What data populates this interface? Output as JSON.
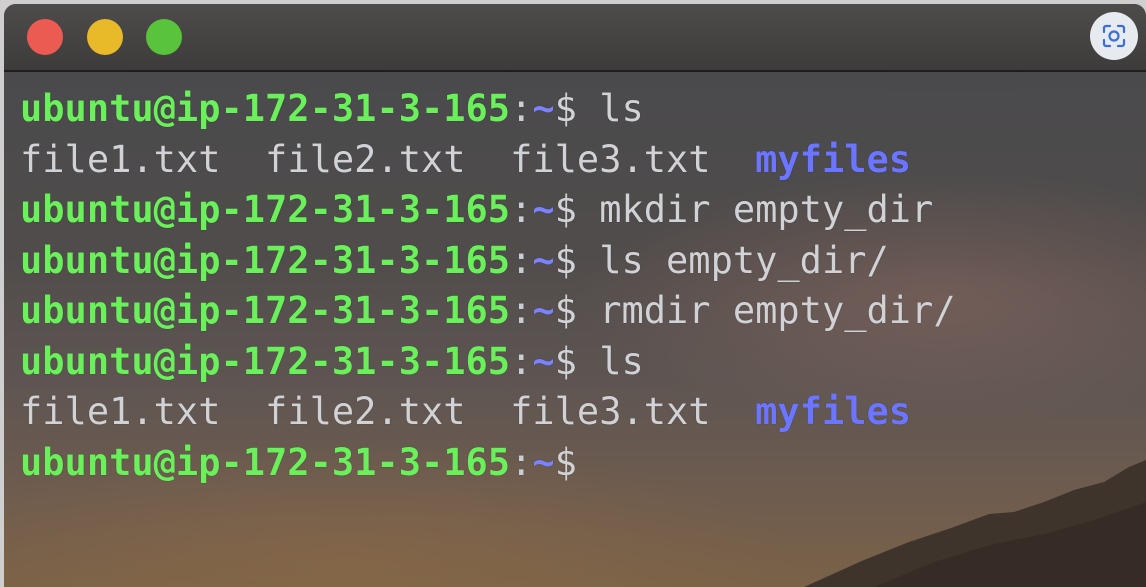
{
  "window": {
    "controls": [
      "close",
      "minimize",
      "zoom"
    ],
    "capture_icon": "screen-capture-icon"
  },
  "colors": {
    "prompt_user": "#6af05a",
    "prompt_path": "#7b82ff",
    "directory": "#6b75ff",
    "text": "#d0d2d6"
  },
  "terminal": {
    "lines": [
      {
        "type": "prompt",
        "user": "ubuntu@ip-172-31-3-165",
        "sep": ":",
        "path": "~",
        "dollar": "$",
        "cmd": " ls"
      },
      {
        "type": "output",
        "files": [
          "file1.txt",
          "file2.txt",
          "file3.txt"
        ],
        "dir": "myfiles"
      },
      {
        "type": "prompt",
        "user": "ubuntu@ip-172-31-3-165",
        "sep": ":",
        "path": "~",
        "dollar": "$",
        "cmd": " mkdir empty_dir"
      },
      {
        "type": "prompt",
        "user": "ubuntu@ip-172-31-3-165",
        "sep": ":",
        "path": "~",
        "dollar": "$",
        "cmd": " ls empty_dir/"
      },
      {
        "type": "prompt",
        "user": "ubuntu@ip-172-31-3-165",
        "sep": ":",
        "path": "~",
        "dollar": "$",
        "cmd": " rmdir empty_dir/"
      },
      {
        "type": "prompt",
        "user": "ubuntu@ip-172-31-3-165",
        "sep": ":",
        "path": "~",
        "dollar": "$",
        "cmd": " ls"
      },
      {
        "type": "output",
        "files": [
          "file1.txt",
          "file2.txt",
          "file3.txt"
        ],
        "dir": "myfiles"
      },
      {
        "type": "prompt",
        "user": "ubuntu@ip-172-31-3-165",
        "sep": ":",
        "path": "~",
        "dollar": "$",
        "cmd": ""
      }
    ]
  }
}
